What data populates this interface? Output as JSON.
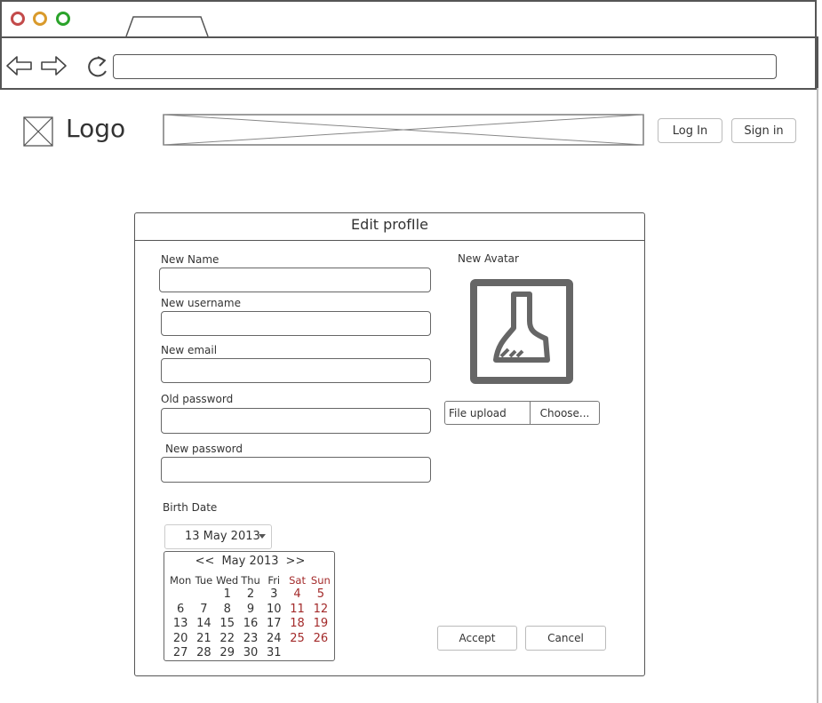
{
  "browser": {
    "dots": [
      {
        "name": "close",
        "color": "#c34a4a"
      },
      {
        "name": "minimize",
        "color": "#d99a2b"
      },
      {
        "name": "maximize",
        "color": "#2aa32a"
      }
    ]
  },
  "header": {
    "logo_text": "Logo",
    "login_label": "Log In",
    "signin_label": "Sign in"
  },
  "dialog": {
    "title": "Edit profIle",
    "fields": {
      "name_label": "New Name",
      "username_label": "New username",
      "email_label": "New email",
      "old_password_label": "Old password",
      "new_password_label": "New password"
    },
    "avatar_label": "New Avatar",
    "upload": {
      "label": "File upload",
      "button": "Choose..."
    },
    "birth_date_label": "Birth Date",
    "date_value": "13 May 2013",
    "calendar": {
      "prev": "<<",
      "month_label": "May 2013",
      "next": ">>",
      "weekdays": [
        "Mon",
        "Tue",
        "Wed",
        "Thu",
        "Fri",
        "Sat",
        "Sun"
      ],
      "weeks": [
        [
          "",
          "",
          "1",
          "2",
          "3",
          "4",
          "5"
        ],
        [
          "6",
          "7",
          "8",
          "9",
          "10",
          "11",
          "12"
        ],
        [
          "13",
          "14",
          "15",
          "16",
          "17",
          "18",
          "19"
        ],
        [
          "20",
          "21",
          "22",
          "23",
          "24",
          "25",
          "26"
        ],
        [
          "27",
          "28",
          "29",
          "30",
          "31",
          "",
          ""
        ]
      ]
    },
    "accept_label": "Accept",
    "cancel_label": "Cancel"
  }
}
